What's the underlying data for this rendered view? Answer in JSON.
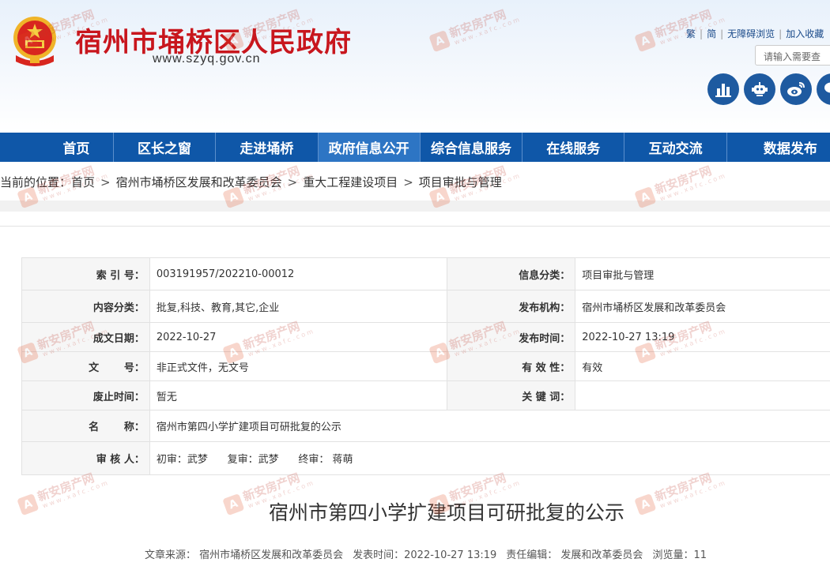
{
  "header": {
    "site_title": "宿州市埇桥区人民政府",
    "site_domain": "www.szyq.gov.cn",
    "top_links": [
      "繁",
      "简",
      "无障碍浏览",
      "加入收藏"
    ],
    "search_placeholder": "请输入需要查",
    "social_icons": [
      "chart-icon",
      "robot-icon",
      "weibo-icon",
      "wechat-icon"
    ]
  },
  "nav": {
    "items": [
      "首页",
      "区长之窗",
      "走进埇桥",
      "政府信息公开",
      "综合信息服务",
      "在线服务",
      "互动交流",
      "数据发布"
    ],
    "active_index": 3
  },
  "breadcrumb": {
    "prefix": "当前的位置：",
    "items": [
      "首页",
      "宿州市埇桥区发展和改革委员会",
      "重大工程建设项目",
      "项目审批与管理"
    ],
    "separator": ">"
  },
  "info": {
    "index_no_label": "索 引 号：",
    "index_no": "003191957/202210-00012",
    "category_label": "信息分类：",
    "category": "项目审批与管理",
    "content_type_label": "内容分类：",
    "content_type": "批复,科技、教育,其它,企业",
    "publisher_label": "发布机构：",
    "publisher": "宿州市埇桥区发展和改革委员会",
    "created_date_label": "成文日期：",
    "created_date": "2022-10-27",
    "publish_time_label": "发布时间：",
    "publish_time": "2022-10-27 13:19",
    "doc_no_label": "文       号：",
    "doc_no": "非正式文件，无文号",
    "validity_label": "有 效 性：",
    "validity": "有效",
    "abolish_label": "废止时间：",
    "abolish": "暂无",
    "keywords_label": "关 键 词：",
    "keywords": "",
    "name_label": "名       称：",
    "name": "宿州市第四小学扩建项目可研批复的公示",
    "review_label": "审 核 人：",
    "review": "初审：武梦      复审：武梦      终审： 蒋萌"
  },
  "article": {
    "title": "宿州市第四小学扩建项目可研批复的公示",
    "source": "文章来源： 宿州市埇桥区发展和改革委员会",
    "time": "发表时间：2022-10-27 13:19",
    "editor": "责任编辑： 发展和改革委员会",
    "views": "浏览量：11"
  },
  "watermark": {
    "logo": "A",
    "text": "新安房产网",
    "sub": "w w w . x a f c . c o m"
  },
  "colors": {
    "nav_bg": "#0f57a8",
    "nav_active": "#2d75c4",
    "title_red": "#c8161d",
    "social_blue": "#1e5aa0"
  }
}
